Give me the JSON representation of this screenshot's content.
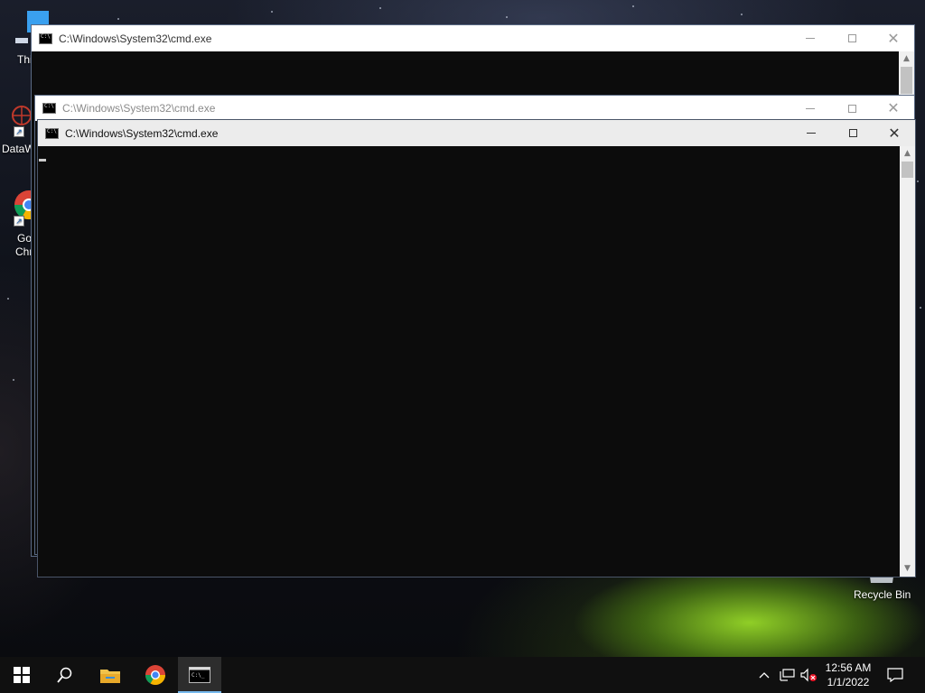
{
  "desktop": {
    "icons": [
      {
        "label": "Thi",
        "name": "this-pc"
      },
      {
        "label": "DataW",
        "name": "datawrapper"
      },
      {
        "label": "Go",
        "label2": "Chr",
        "name": "google-chrome"
      },
      {
        "label": "Recycle Bin",
        "name": "recycle-bin"
      }
    ]
  },
  "windows": [
    {
      "title": "C:\\Windows\\System32\\cmd.exe",
      "state": "inactive"
    },
    {
      "title": "C:\\Windows\\System32\\cmd.exe",
      "state": "inactive"
    },
    {
      "title": "C:\\Windows\\System32\\cmd.exe",
      "state": "active"
    }
  ],
  "taskbar": {
    "start": "start-icon",
    "search": "search-icon",
    "pinned": [
      "file-explorer-icon",
      "chrome-icon",
      "cmd-icon"
    ],
    "clock": {
      "time": "12:56 AM",
      "date": "1/1/2022"
    }
  },
  "colors": {
    "console_bg": "#0c0c0c",
    "taskbar_bg": "#101010",
    "active_indicator": "#76b9ed"
  }
}
